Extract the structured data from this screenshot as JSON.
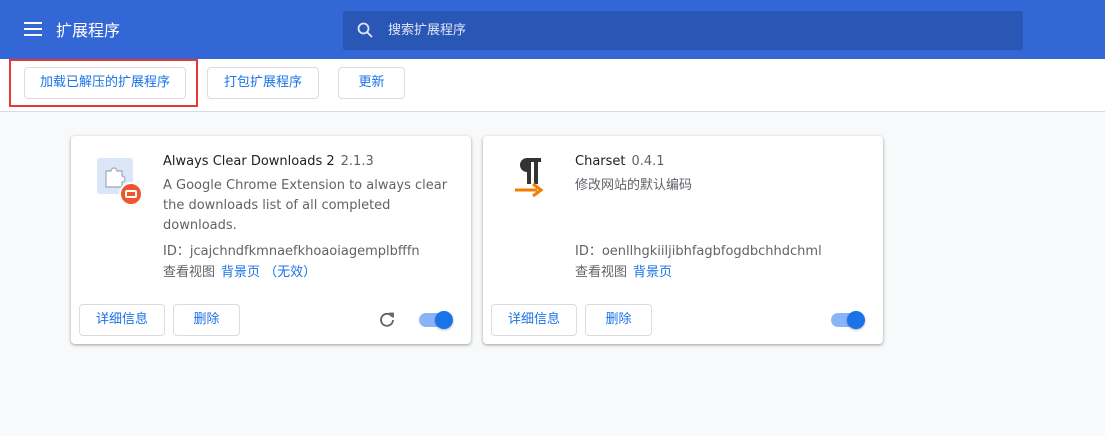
{
  "header": {
    "title": "扩展程序",
    "search_placeholder": "搜索扩展程序",
    "color": "#3367d6"
  },
  "toolbar": {
    "load_unpacked": "加载已解压的扩展程序",
    "pack": "打包扩展程序",
    "update": "更新"
  },
  "extensions": [
    {
      "name": "Always Clear Downloads 2",
      "version": "2.1.3",
      "description": "A Google Chrome Extension to always clear the downloads list of all completed downloads.",
      "id_label": "ID：jcajchndfkmnaefkhoaoiagemplbfffn",
      "inspect_label": "查看视图",
      "link": "背景页 （无效）",
      "details_button": "详细信息",
      "remove_button": "删除",
      "enabled": true
    },
    {
      "name": "Charset",
      "version": "0.4.1",
      "description": "修改网站的默认编码",
      "id_label": "ID：oenllhgkiiljibhfagbfogdbchhdchml",
      "inspect_label": "查看视图",
      "link": "背景页",
      "details_button": "详细信息",
      "remove_button": "删除",
      "enabled": true
    }
  ]
}
